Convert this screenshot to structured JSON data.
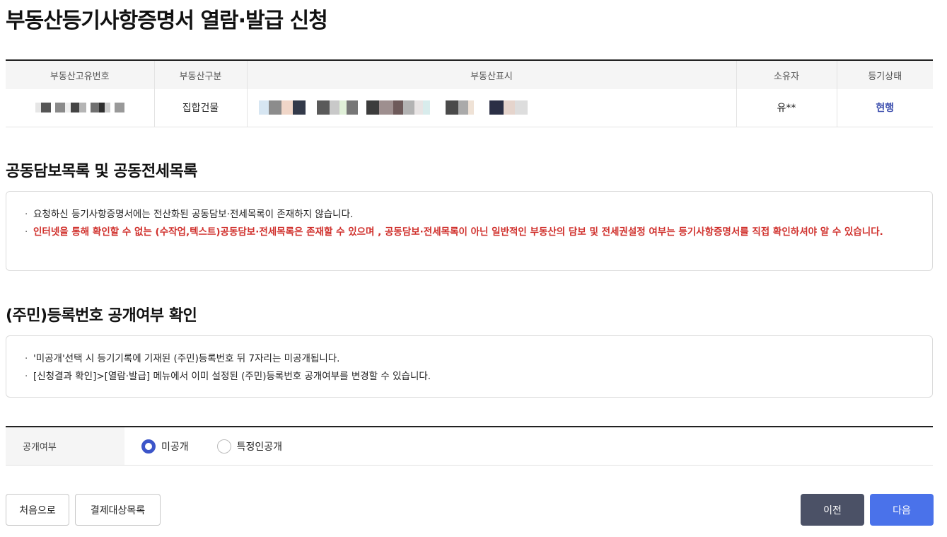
{
  "page_title": "부동산등기사항증명서 열람·발급 신청",
  "property_table": {
    "headers": [
      "부동산고유번호",
      "부동산구분",
      "부동산표시",
      "소유자",
      "등기상태"
    ],
    "row": {
      "category": "집합건물",
      "owner": "유**",
      "status": "현행"
    }
  },
  "joint_section": {
    "title": "공동담보목록 및 공동전세목록",
    "notices": [
      "요청하신 등기사항증명서에는 전산화된 공동담보·전세목록이 존재하지 않습니다.",
      "인터넷을 통해 확인할 수 없는 (수작업,텍스트)공동담보·전세목록은 존재할 수 있으며 , 공동담보·전세목록이 아닌 일반적인 부동산의 담보 및 전세권설정 여부는 등기사항증명서를 직접 확인하셔야 알 수 있습니다."
    ]
  },
  "resident_section": {
    "title": "(주민)등록번호 공개여부 확인",
    "notices": [
      "'미공개'선택 시 등기기록에 기재된 (주민)등록번호 뒤 7자리는 미공개됩니다.",
      "[신청결과 확인]>[열람·발급] 메뉴에서 이미 설정된 (주민)등록번호 공개여부를 변경할 수 있습니다."
    ]
  },
  "disclosure": {
    "label": "공개여부",
    "options": [
      {
        "label": "미공개",
        "selected": true
      },
      {
        "label": "특정인공개",
        "selected": false
      }
    ]
  },
  "buttons": {
    "home": "처음으로",
    "payment_list": "결제대상목록",
    "prev": "이전",
    "next": "다음"
  },
  "colors": {
    "accent": "#3c55c9",
    "warning": "#d0312d",
    "status": "#3d4fae",
    "dark_button": "#4b5166",
    "primary_button": "#4a72ea"
  }
}
